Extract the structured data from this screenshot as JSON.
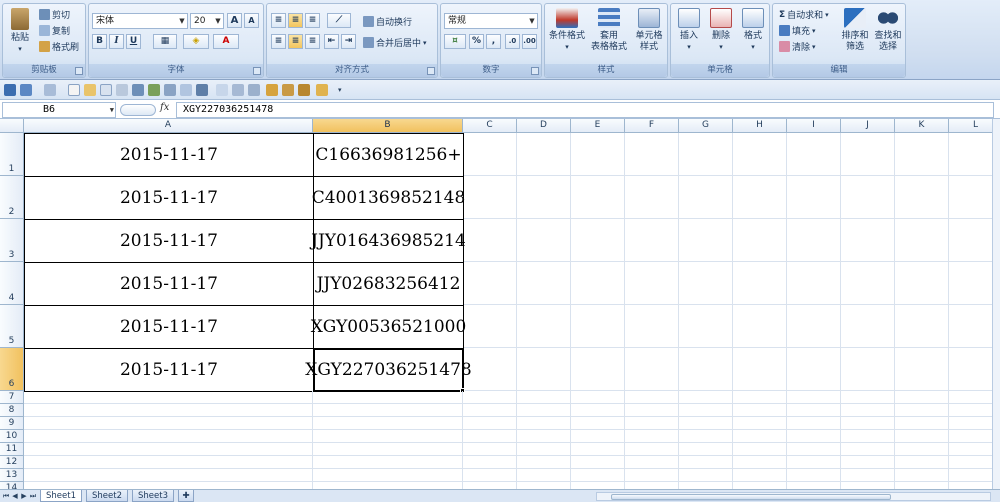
{
  "ribbon": {
    "clipboard": {
      "title": "剪贴板",
      "paste": "粘贴",
      "cut": "剪切",
      "copy": "复制",
      "format_painter": "格式刷"
    },
    "font": {
      "title": "字体",
      "name": "宋体",
      "size": "20",
      "bold": "B",
      "italic": "I",
      "underline": "U",
      "grow": "A",
      "shrink": "A"
    },
    "alignment": {
      "title": "对齐方式",
      "wrap": "自动换行",
      "merge": "合并后居中"
    },
    "number": {
      "title": "数字",
      "format": "常规",
      "percent": "%",
      "comma": ","
    },
    "styles": {
      "title": "样式",
      "conditional": "条件格式",
      "table": "套用\n表格格式",
      "cell": "单元格\n样式"
    },
    "cells": {
      "title": "单元格",
      "insert": "插入",
      "delete": "删除",
      "format": "格式"
    },
    "editing": {
      "title": "编辑",
      "autosum": "自动求和",
      "fill": "填充",
      "clear": "清除",
      "sort": "排序和\n筛选",
      "find": "查找和\n选择"
    }
  },
  "formula_bar": {
    "cell_ref": "B6",
    "fx": "fx",
    "value": "XGY227036251478"
  },
  "columns": [
    "A",
    "B",
    "C",
    "D",
    "E",
    "F",
    "G",
    "H",
    "I",
    "J",
    "K",
    "L"
  ],
  "rows": [
    {
      "num": "1",
      "a": "2015-11-17",
      "b": "C16636981256+"
    },
    {
      "num": "2",
      "a": "2015-11-17",
      "b": "C4001369852148"
    },
    {
      "num": "3",
      "a": "2015-11-17",
      "b": "JJY016436985214"
    },
    {
      "num": "4",
      "a": "2015-11-17",
      "b": "JJY02683256412"
    },
    {
      "num": "5",
      "a": "2015-11-17",
      "b": "XGY00536521000"
    },
    {
      "num": "6",
      "a": "2015-11-17",
      "b": "XGY227036251478"
    }
  ],
  "small_rows": [
    "7",
    "8",
    "9",
    "10",
    "11",
    "12",
    "13",
    "14"
  ],
  "sheets": [
    {
      "name": "Sheet1",
      "active": true
    },
    {
      "name": "Sheet2",
      "active": false
    },
    {
      "name": "Sheet3",
      "active": false
    }
  ],
  "colors": {
    "selected_header": "#f1c15f",
    "ribbon": "#d0def0",
    "grid_line": "#d9e2ee"
  }
}
